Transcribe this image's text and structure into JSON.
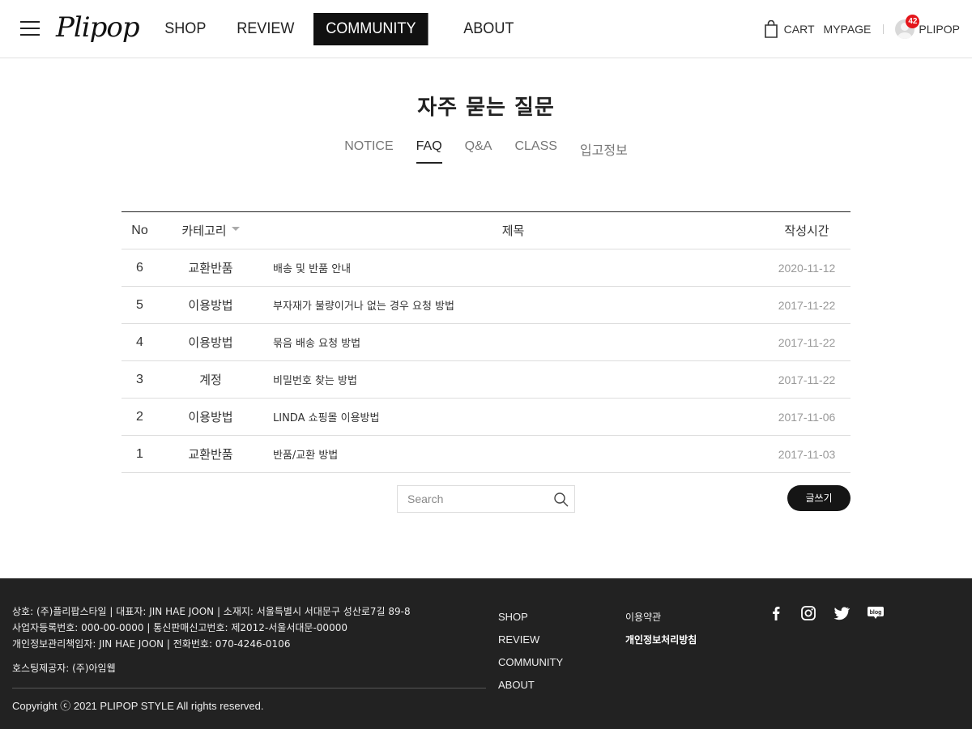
{
  "header": {
    "logo": "Plipop",
    "nav": [
      "SHOP",
      "REVIEW",
      "COMMUNITY",
      "ABOUT"
    ],
    "active_nav": "COMMUNITY",
    "cart_label": "CART",
    "mypage_label": "MYPAGE",
    "user_name": "PLIPOP",
    "notification_count": "42"
  },
  "main": {
    "title": "자주 묻는 질문",
    "tabs": [
      "NOTICE",
      "FAQ",
      "Q&A",
      "CLASS",
      "입고정보"
    ],
    "active_tab": "FAQ",
    "table": {
      "headers": {
        "no": "No",
        "category": "카테고리",
        "title": "제목",
        "date": "작성시간"
      },
      "rows": [
        {
          "no": "6",
          "category": "교환반품",
          "title": "배송 및 반품 안내",
          "date": "2020-11-12"
        },
        {
          "no": "5",
          "category": "이용방법",
          "title": "부자재가 불량이거나 없는 경우 요청 방법",
          "date": "2017-11-22"
        },
        {
          "no": "4",
          "category": "이용방법",
          "title": "묶음 배송 요청 방법",
          "date": "2017-11-22"
        },
        {
          "no": "3",
          "category": "계정",
          "title": "비밀번호 찾는 방법",
          "date": "2017-11-22"
        },
        {
          "no": "2",
          "category": "이용방법",
          "title": "LINDA 쇼핑몰 이용방법",
          "date": "2017-11-06"
        },
        {
          "no": "1",
          "category": "교환반품",
          "title": "반품/교환 방법",
          "date": "2017-11-03"
        }
      ]
    },
    "search_placeholder": "Search",
    "write_button": "글쓰기"
  },
  "footer": {
    "info_lines": [
      "상호: (주)플리팝스타일 | 대표자: JIN HAE JOON | 소재지: 서울특별시 서대문구 성산로7길 89-8",
      "사업자등록번호: 000-00-0000 | 통신판매신고번호: 제2012-서울서대문-00000",
      "개인정보관리책임자: JIN HAE JOON | 전화번호: 070-4246-0106"
    ],
    "hosting": "호스팅제공자: (주)아임웹",
    "copyright": "Copyright ⓒ 2021 PLIPOP STYLE All rights reserved.",
    "nav": [
      "SHOP",
      "REVIEW",
      "COMMUNITY",
      "ABOUT"
    ],
    "terms": "이용약관",
    "privacy": "개인정보처리방침",
    "social": [
      "facebook-icon",
      "instagram-icon",
      "twitter-icon",
      "blog-icon"
    ],
    "social_blog_text": "blog"
  },
  "colors": {
    "accent": "#111111",
    "footer_bg": "#222222",
    "badge": "#e4161b",
    "date_text": "#999999"
  }
}
